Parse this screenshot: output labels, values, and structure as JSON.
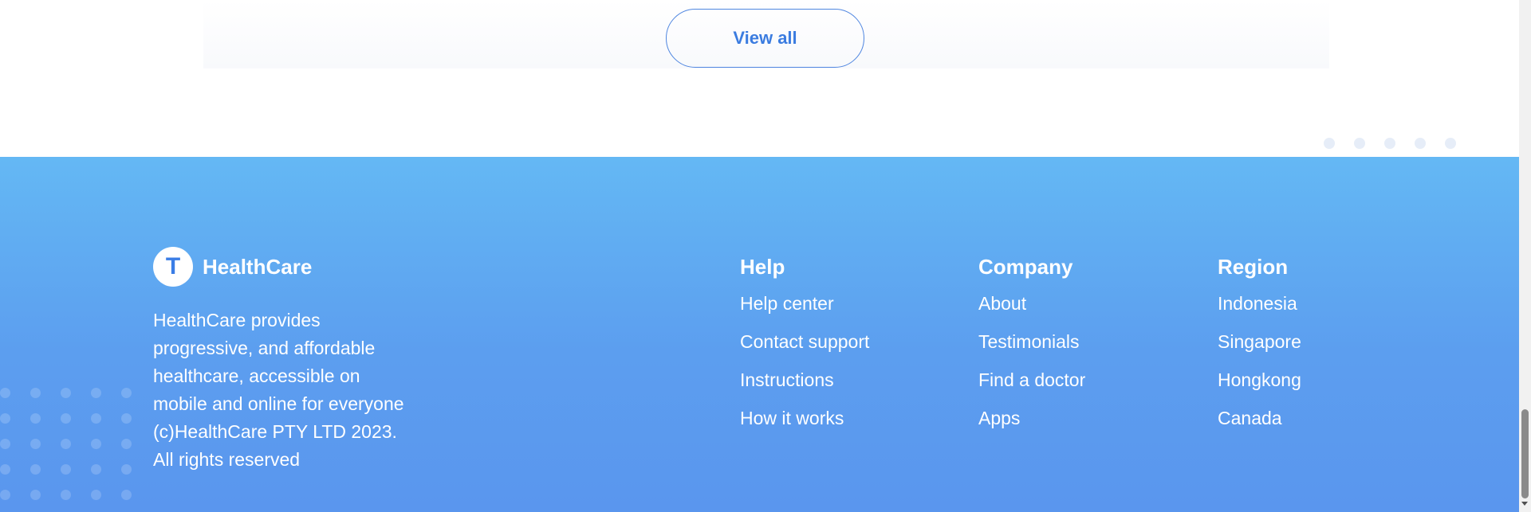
{
  "view_all_label": "View all",
  "brand": {
    "logo_letter": "T",
    "name": "HealthCare",
    "description": "HealthCare provides progressive, and affordable healthcare, accessible on mobile and online for everyone",
    "copyright": "(c)HealthCare PTY LTD 2023. All rights reserved"
  },
  "columns": [
    {
      "title": "Help",
      "items": [
        "Help center",
        "Contact support",
        "Instructions",
        "How it works"
      ]
    },
    {
      "title": "Company",
      "items": [
        "About",
        "Testimonials",
        "Find a doctor",
        "Apps"
      ]
    },
    {
      "title": "Region",
      "items": [
        "Indonesia",
        "Singapore",
        "Hongkong",
        "Canada"
      ]
    }
  ],
  "colors": {
    "accent": "#3b7ce0",
    "footer_top": "#64b8f4",
    "footer_bottom": "#5a96ee"
  }
}
